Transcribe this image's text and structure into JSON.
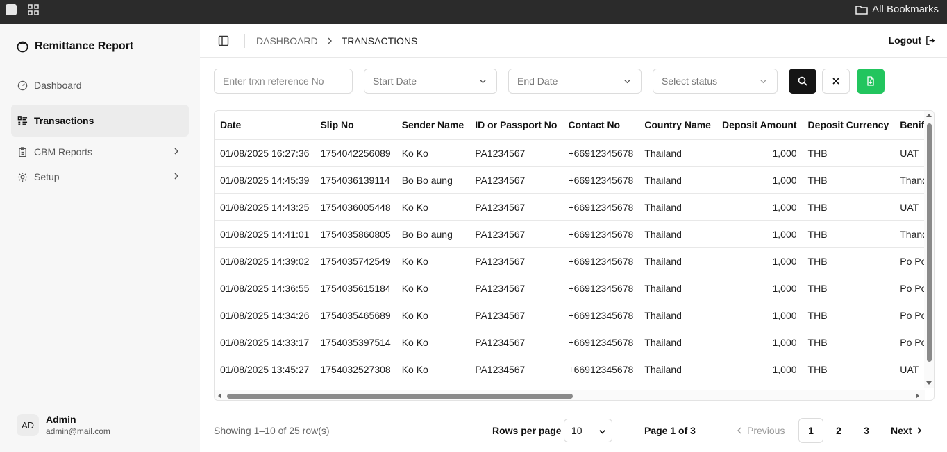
{
  "browser": {
    "bookmarks_label": "All Bookmarks"
  },
  "sidebar": {
    "brand": "Remittance Report",
    "items": [
      {
        "label": "Dashboard"
      },
      {
        "label": "Transactions"
      },
      {
        "label": "CBM Reports"
      },
      {
        "label": "Setup"
      }
    ],
    "active_item": "Transactions",
    "user": {
      "initials": "AD",
      "name": "Admin",
      "email": "admin@mail.com"
    }
  },
  "header": {
    "breadcrumb": [
      "DASHBOARD",
      "TRANSACTIONS"
    ],
    "logout_label": "Logout"
  },
  "filters": {
    "reference_placeholder": "Enter trxn reference No",
    "start_date": "Start Date",
    "end_date": "End Date",
    "status": "Select status"
  },
  "table": {
    "columns": [
      "Date",
      "Slip No",
      "Sender Name",
      "ID or Passport No",
      "Contact No",
      "Country Name",
      "Deposit Amount",
      "Deposit Currency",
      "Benificiary Name"
    ],
    "rows": [
      [
        "01/08/2025 16:27:36",
        "1754042256089",
        "Ko Ko",
        "PA1234567",
        "+66912345678",
        "Thailand",
        "1,000",
        "THB",
        "UAT"
      ],
      [
        "01/08/2025 14:45:39",
        "1754036139114",
        "Bo Bo aung",
        "PA1234567",
        "+66912345678",
        "Thailand",
        "1,000",
        "THB",
        "Thandar"
      ],
      [
        "01/08/2025 14:43:25",
        "1754036005448",
        "Ko Ko",
        "PA1234567",
        "+66912345678",
        "Thailand",
        "1,000",
        "THB",
        "UAT"
      ],
      [
        "01/08/2025 14:41:01",
        "1754035860805",
        "Bo Bo aung",
        "PA1234567",
        "+66912345678",
        "Thailand",
        "1,000",
        "THB",
        "Thandar"
      ],
      [
        "01/08/2025 14:39:02",
        "1754035742549",
        "Ko Ko",
        "PA1234567",
        "+66912345678",
        "Thailand",
        "1,000",
        "THB",
        "Po Po"
      ],
      [
        "01/08/2025 14:36:55",
        "1754035615184",
        "Ko Ko",
        "PA1234567",
        "+66912345678",
        "Thailand",
        "1,000",
        "THB",
        "Po Po"
      ],
      [
        "01/08/2025 14:34:26",
        "1754035465689",
        "Ko Ko",
        "PA1234567",
        "+66912345678",
        "Thailand",
        "1,000",
        "THB",
        "Po Po"
      ],
      [
        "01/08/2025 14:33:17",
        "1754035397514",
        "Ko Ko",
        "PA1234567",
        "+66912345678",
        "Thailand",
        "1,000",
        "THB",
        "Po Po"
      ],
      [
        "01/08/2025 13:45:27",
        "1754032527308",
        "Ko Ko",
        "PA1234567",
        "+66912345678",
        "Thailand",
        "1,000",
        "THB",
        "UAT"
      ]
    ]
  },
  "pagination": {
    "summary": "Showing 1–10 of 25 row(s)",
    "rows_per_page_label": "Rows per page",
    "rows_per_page_value": "10",
    "page_of": "Page 1 of 3",
    "previous_label": "Previous",
    "pages": [
      "1",
      "2",
      "3"
    ],
    "current_page": "1",
    "next_label": "Next"
  },
  "colors": {
    "accent_export": "#22c55e",
    "search_button": "#151515",
    "sidebar_bg": "#f7f7f7"
  }
}
